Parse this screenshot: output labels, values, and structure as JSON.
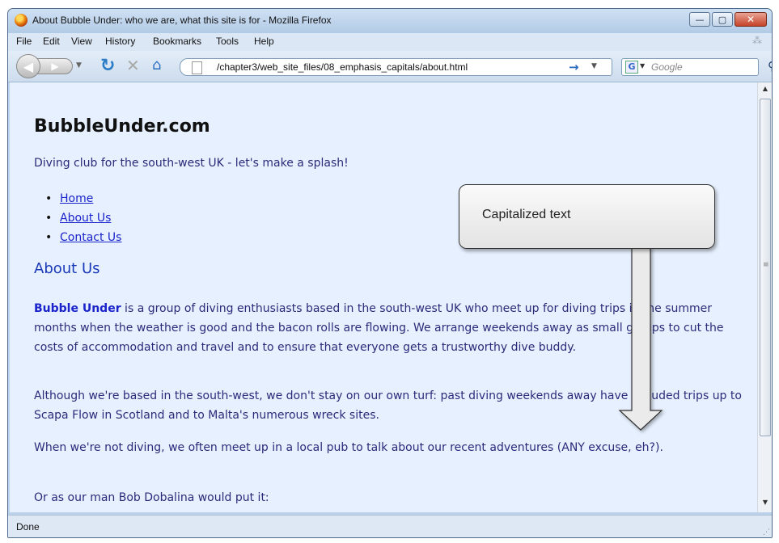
{
  "window": {
    "title": "About Bubble Under: who we are, what this site is for - Mozilla Firefox",
    "controls": {
      "minimize": "—",
      "maximize": "▢",
      "close": "✕"
    }
  },
  "menu": {
    "items": [
      "File",
      "Edit",
      "View",
      "History",
      "Bookmarks",
      "Tools",
      "Help"
    ]
  },
  "navigation": {
    "url": "/chapter3/web_site_files/08_emphasis_capitals/about.html",
    "search_placeholder": "Google",
    "icons": [
      "back-icon",
      "forward-icon",
      "reload-icon",
      "stop-icon",
      "home-icon",
      "go-arrow-icon",
      "search-icon"
    ]
  },
  "page": {
    "site_title": "BubbleUnder.com",
    "tagline": "Diving club for the south-west UK - let's make a splash!",
    "nav_links": [
      "Home",
      "About Us",
      "Contact Us"
    ],
    "heading": "About Us",
    "para1_brand": "Bubble Under",
    "para1_rest": " is a group of diving enthusiasts based in the south-west UK who meet up for diving trips in the summer months when the weather is good and the bacon rolls are flowing. We arrange weekends away as small groups to cut the costs of accommodation and travel and to ensure that everyone gets a trustworthy dive buddy.",
    "para2": "Although we're based in the south-west, we don't stay on our own turf: past diving weekends away have included trips up to Scapa Flow in Scotland and to Malta's numerous wreck sites.",
    "para3": "When we're not diving, we often meet up in a local pub to talk about our recent adventures (ANY excuse, eh?).",
    "para4": "Or as our man Bob Dobalina would put it:"
  },
  "callout": {
    "text": "Capitalized text"
  },
  "status": {
    "text": "Done"
  },
  "colors": {
    "page_bg": "#e6f0fe",
    "link": "#1b23cc",
    "body_text": "#2b2b7a",
    "heading": "#1b3ab8"
  }
}
